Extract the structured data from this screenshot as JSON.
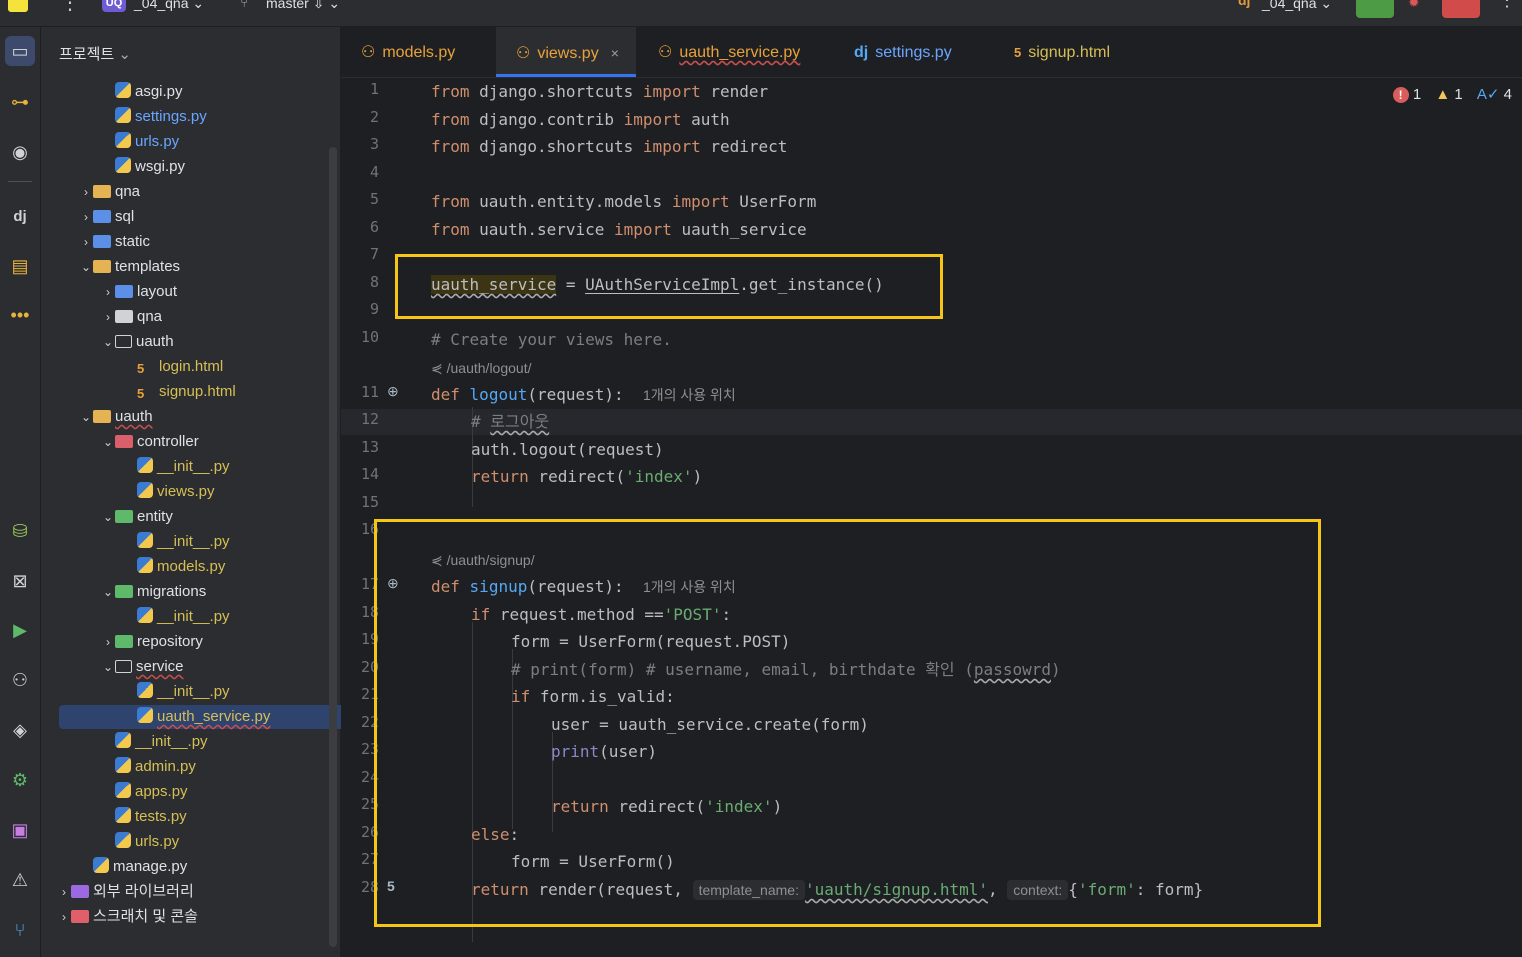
{
  "topbar": {
    "project_badge": "UQ",
    "project_name": "_04_qna",
    "branch": "master",
    "right_project_badge": "dj",
    "right_project": "_04_qna"
  },
  "activity_icons": [
    "project-icon",
    "commit-icon",
    "github-icon",
    "django-icon",
    "structure-icon",
    "more-icon",
    "database-icon",
    "excel-icon",
    "run-icon",
    "python-icon",
    "layers-icon",
    "settings-icon",
    "terminal-icon",
    "problems-icon",
    "git-icon"
  ],
  "project_panel": {
    "title": "프로젝트",
    "items": [
      {
        "label": "asgi.py",
        "type": "py",
        "depth": 3,
        "color": "default"
      },
      {
        "label": "settings.py",
        "type": "py",
        "depth": 3,
        "color": "blue"
      },
      {
        "label": "urls.py",
        "type": "py",
        "depth": 3,
        "color": "blue"
      },
      {
        "label": "wsgi.py",
        "type": "py",
        "depth": 3,
        "color": "default"
      },
      {
        "label": "qna",
        "type": "folder",
        "depth": 2,
        "chev": ">",
        "color": "default"
      },
      {
        "label": "sql",
        "type": "folder-blue",
        "depth": 2,
        "chev": ">",
        "color": "default"
      },
      {
        "label": "static",
        "type": "folder-blue",
        "depth": 2,
        "chev": ">",
        "color": "default"
      },
      {
        "label": "templates",
        "type": "folder",
        "depth": 2,
        "chev": "v",
        "color": "default"
      },
      {
        "label": "layout",
        "type": "folder-blue",
        "depth": 3,
        "chev": ">",
        "color": "default"
      },
      {
        "label": "qna",
        "type": "folder-grey",
        "depth": 3,
        "chev": ">",
        "color": "default"
      },
      {
        "label": "uauth",
        "type": "folder-outline",
        "depth": 3,
        "chev": "v",
        "color": "default"
      },
      {
        "label": "login.html",
        "type": "html",
        "depth": 4,
        "color": "yellow"
      },
      {
        "label": "signup.html",
        "type": "html",
        "depth": 4,
        "color": "yellow"
      },
      {
        "label": "uauth",
        "type": "folder",
        "depth": 2,
        "chev": "v",
        "color": "default",
        "underline": true
      },
      {
        "label": "controller",
        "type": "folder-red",
        "depth": 3,
        "chev": "v",
        "color": "default"
      },
      {
        "label": "__init__.py",
        "type": "py",
        "depth": 4,
        "color": "yellow"
      },
      {
        "label": "views.py",
        "type": "py",
        "depth": 4,
        "color": "yellow"
      },
      {
        "label": "entity",
        "type": "folder-green",
        "depth": 3,
        "chev": "v",
        "color": "default"
      },
      {
        "label": "__init__.py",
        "type": "py",
        "depth": 4,
        "color": "yellow"
      },
      {
        "label": "models.py",
        "type": "py",
        "depth": 4,
        "color": "yellow"
      },
      {
        "label": "migrations",
        "type": "folder-green",
        "depth": 3,
        "chev": "v",
        "color": "default"
      },
      {
        "label": "__init__.py",
        "type": "py",
        "depth": 4,
        "color": "yellow"
      },
      {
        "label": "repository",
        "type": "folder-green",
        "depth": 3,
        "chev": ">",
        "color": "default"
      },
      {
        "label": "service",
        "type": "folder-outline",
        "depth": 3,
        "chev": "v",
        "color": "default",
        "underline": true
      },
      {
        "label": "__init__.py",
        "type": "py",
        "depth": 4,
        "color": "yellow"
      },
      {
        "label": "uauth_service.py",
        "type": "py",
        "depth": 4,
        "color": "yellow",
        "selected": true,
        "underline": true
      },
      {
        "label": "__init__.py",
        "type": "py",
        "depth": 3,
        "color": "yellow"
      },
      {
        "label": "admin.py",
        "type": "py",
        "depth": 3,
        "color": "yellow"
      },
      {
        "label": "apps.py",
        "type": "py",
        "depth": 3,
        "color": "yellow"
      },
      {
        "label": "tests.py",
        "type": "py",
        "depth": 3,
        "color": "yellow"
      },
      {
        "label": "urls.py",
        "type": "py",
        "depth": 3,
        "color": "yellow"
      },
      {
        "label": "manage.py",
        "type": "py",
        "depth": 2,
        "color": "default"
      },
      {
        "label": "외부 라이브러리",
        "type": "lib",
        "depth": 1,
        "chev": ">",
        "color": "default"
      },
      {
        "label": "스크래치 및 콘솔",
        "type": "scratch",
        "depth": 1,
        "chev": ">",
        "color": "default"
      }
    ]
  },
  "tabs": [
    {
      "label": "models.py",
      "icon": "python-icon",
      "active": false
    },
    {
      "label": "views.py",
      "icon": "python-icon",
      "active": true,
      "close": "×"
    },
    {
      "label": "uauth_service.py",
      "icon": "python-icon",
      "active": false,
      "underline": true
    },
    {
      "label": "settings.py",
      "icon": "django-icon",
      "icon_text": "dj",
      "active": false
    },
    {
      "label": "signup.html",
      "icon": "html-icon",
      "active": false
    }
  ],
  "inspections": {
    "errors": "1",
    "warnings": "1",
    "typos": "4"
  },
  "line_numbers": [
    "1",
    "2",
    "3",
    "4",
    "5",
    "6",
    "7",
    "8",
    "9",
    "10",
    "11",
    "12",
    "13",
    "14",
    "15",
    "16",
    "17",
    "18",
    "19",
    "20",
    "21",
    "22",
    "23",
    "24",
    "25",
    "26",
    "27",
    "28"
  ],
  "code": {
    "l1": [
      "from",
      " django.shortcuts ",
      "import",
      " render"
    ],
    "l2": [
      "from",
      " django.contrib ",
      "import",
      " auth"
    ],
    "l3": [
      "from",
      " django.shortcuts ",
      "import",
      " redirect"
    ],
    "l5": [
      "from",
      " uauth.entity.models ",
      "import",
      " UserForm"
    ],
    "l6": [
      "from",
      " uauth.service ",
      "import",
      " uauth_service"
    ],
    "l8": [
      "uauth_service",
      " = ",
      "UAuthServiceImpl",
      ".get_instance()"
    ],
    "l10": "# Create your views here.",
    "route_logout": "/uauth/logout/",
    "l11": [
      "def",
      " ",
      "logout",
      "(request):"
    ],
    "usage_hint": "1개의 사용 위치",
    "l12": [
      "# ",
      "로그아웃"
    ],
    "l13": "auth.logout(request)",
    "l14": [
      "return",
      " redirect(",
      "'index'",
      ")"
    ],
    "route_signup": "/uauth/signup/",
    "l17": [
      "def",
      " ",
      "signup",
      "(request):"
    ],
    "l18": [
      "if",
      " request.method ==",
      "'POST'",
      ":"
    ],
    "l19": "form = UserForm(request.POST)",
    "l20": [
      "# print(form) # username, email, birthdate 확인 (",
      "passowrd",
      ")"
    ],
    "l21": [
      "if",
      " form.is_valid:"
    ],
    "l22": "user = uauth_service.create(form)",
    "l23": [
      "print",
      "(user)"
    ],
    "l25": [
      "return",
      " redirect(",
      "'index'",
      ")"
    ],
    "l26": [
      "else",
      ":"
    ],
    "l27": "form = UserForm()",
    "l28": [
      "return",
      " render(request, ",
      "template_name:",
      "'uauth/signup.html'",
      ", ",
      "context:",
      "{",
      "'form'",
      ": form}"
    ]
  }
}
